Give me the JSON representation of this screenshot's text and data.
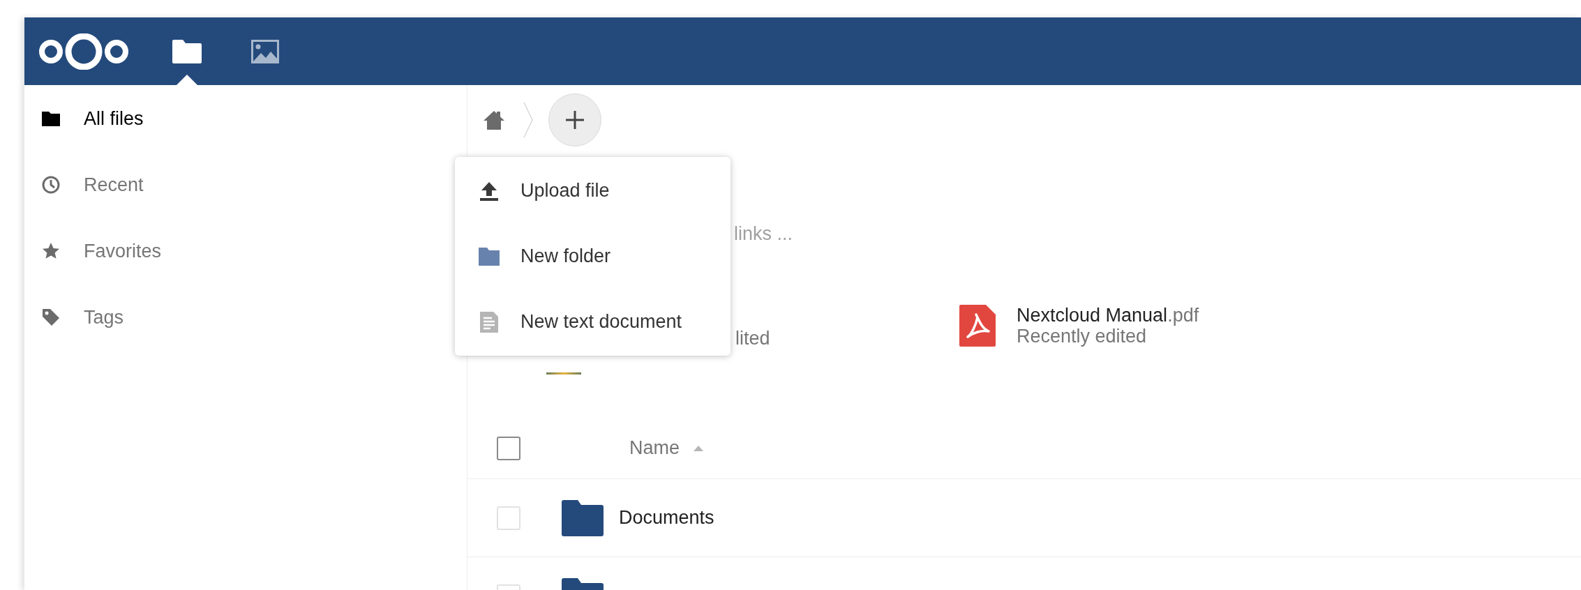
{
  "header": {
    "apps": [
      {
        "kind": "files",
        "selected": true
      },
      {
        "kind": "photos",
        "selected": false
      }
    ]
  },
  "sidebar": {
    "items": [
      {
        "kind": "folder",
        "label": "All files",
        "selected": true
      },
      {
        "kind": "clock",
        "label": "Recent",
        "selected": false
      },
      {
        "kind": "star",
        "label": "Favorites",
        "selected": false
      },
      {
        "kind": "tag",
        "label": "Tags",
        "selected": false
      }
    ]
  },
  "new_menu": {
    "items": [
      {
        "kind": "upload",
        "label": "Upload file"
      },
      {
        "kind": "folder",
        "label": "New folder"
      },
      {
        "kind": "text",
        "label": "New text document"
      }
    ]
  },
  "covered_texts": [
    "links ...",
    "lited"
  ],
  "recent": {
    "items": [
      {
        "name": "Nextcloud Manual",
        "extension": ".pdf",
        "note": "Recently edited"
      }
    ]
  },
  "table": {
    "select_all_checked": false,
    "columns": [
      {
        "label": "Name",
        "sorted": true
      }
    ],
    "rows": [
      {
        "name": "Documents",
        "checked": false
      },
      {
        "checked": false
      }
    ]
  }
}
